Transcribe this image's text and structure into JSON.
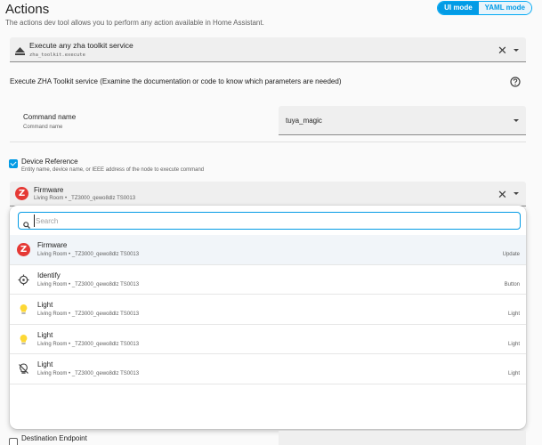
{
  "header": {
    "title": "Actions",
    "subtitle": "The actions dev tool allows you to perform any action available in Home Assistant.",
    "ui_mode_label": "UI mode",
    "yaml_mode_label": "YAML mode"
  },
  "service": {
    "title": "Execute any zha toolkit service",
    "id": "zha_toolkit.execute"
  },
  "exec_description": "Execute ZHA Toolkit service (Examine the documentation or code to know which parameters are needed)",
  "command": {
    "label": "Command name",
    "sublabel": "Command name",
    "value": "tuya_magic"
  },
  "device_reference": {
    "label": "Device Reference",
    "sublabel": "Entity name, device name, or IEEE address of the node to execute command",
    "selected_name": "Firmware",
    "selected_location": "Living Room",
    "selected_device": "_TZ3000_qewo8dlz TS0013"
  },
  "dropdown": {
    "search_placeholder": "Search",
    "items": [
      {
        "name": "Firmware",
        "location": "Living Room",
        "device": "_TZ3000_qewo8dlz TS0013",
        "type": "Update",
        "icon": "zigbee-logo"
      },
      {
        "name": "Identify",
        "location": "Living Room",
        "device": "_TZ3000_qewo8dlz TS0013",
        "type": "Button",
        "icon": "identify-target-icon"
      },
      {
        "name": "Light",
        "location": "Living Room",
        "device": "_TZ3000_qewo8dlz TS0013",
        "type": "Light",
        "icon": "lightbulb-on-icon"
      },
      {
        "name": "Light",
        "location": "Living Room",
        "device": "_TZ3000_qewo8dlz TS0013",
        "type": "Light",
        "icon": "lightbulb-on-icon"
      },
      {
        "name": "Light",
        "location": "Living Room",
        "device": "_TZ3000_qewo8dlz TS0013",
        "type": "Light",
        "icon": "lightbulb-off-icon"
      }
    ]
  },
  "destination": {
    "label": "Destination Endpoint"
  },
  "bullet": "•",
  "colors": {
    "accent": "#039be5",
    "bulb_on": "#fdd835",
    "zigbee": "#e53935"
  }
}
